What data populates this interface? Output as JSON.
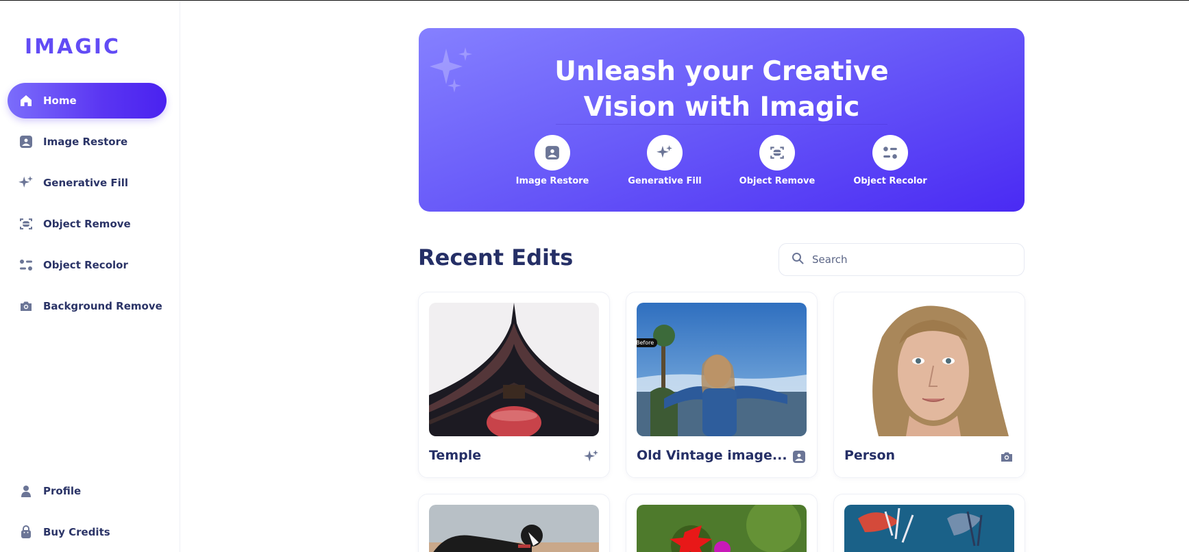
{
  "app": {
    "logo": "IMAGIC"
  },
  "sidebar": {
    "items": [
      {
        "label": "Home",
        "icon": "home-icon",
        "active": true
      },
      {
        "label": "Image Restore",
        "icon": "image-icon"
      },
      {
        "label": "Generative Fill",
        "icon": "sparkles-icon"
      },
      {
        "label": "Object Remove",
        "icon": "scan-object-icon"
      },
      {
        "label": "Object Recolor",
        "icon": "recolor-icon"
      },
      {
        "label": "Background Remove",
        "icon": "camera-icon"
      }
    ],
    "bottom": [
      {
        "label": "Profile",
        "icon": "user-icon"
      },
      {
        "label": "Buy Credits",
        "icon": "bag-icon"
      }
    ]
  },
  "hero": {
    "title_line1": "Unleash your Creative",
    "title_line2": "Vision with Imagic",
    "tools": [
      {
        "label": "Image Restore",
        "icon": "image-icon"
      },
      {
        "label": "Generative Fill",
        "icon": "sparkles-icon"
      },
      {
        "label": "Object Remove",
        "icon": "scan-object-icon"
      },
      {
        "label": "Object Recolor",
        "icon": "recolor-icon"
      }
    ]
  },
  "recent": {
    "title": "Recent Edits",
    "search_placeholder": "Search",
    "cards": [
      {
        "title": "Temple",
        "icon": "sparkles-icon"
      },
      {
        "title": "Old Vintage image...",
        "icon": "image-icon",
        "badge": "Before"
      },
      {
        "title": "Person",
        "icon": "camera-icon"
      },
      {
        "title": "",
        "icon": ""
      },
      {
        "title": "",
        "icon": ""
      },
      {
        "title": "",
        "icon": ""
      }
    ]
  },
  "colors": {
    "accent": "#5a35f2",
    "text_dark": "#252f66",
    "icon_muted": "#6b7596"
  }
}
